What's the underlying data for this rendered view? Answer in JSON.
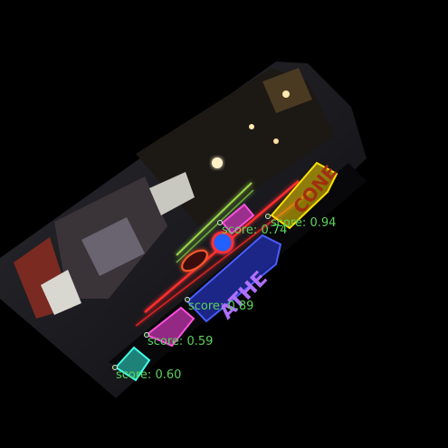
{
  "scene": {
    "description_key": "night-street-neon-signs-rotated",
    "background_color": "#000000",
    "accent_colors": {
      "neon_red": "#ff2d2d",
      "neon_green": "#9bd54a",
      "detection_yellow": "#f0d000",
      "detection_magenta": "#e03cc8",
      "detection_blue": "#2a3bd8",
      "detection_cyan": "#2fd3c2",
      "label_green": "#5ad35a"
    }
  },
  "detections": [
    {
      "id": "det-1",
      "score_text": "score: 0.94",
      "color": "#f0d000"
    },
    {
      "id": "det-2",
      "score_text": "score: 0.74",
      "color": "#e03cc8"
    },
    {
      "id": "det-3",
      "score_text": "score: 0.89",
      "color": "#2a3bd8"
    },
    {
      "id": "det-4",
      "score_text": "score: 0.59",
      "color": "#e03cc8"
    },
    {
      "id": "det-5",
      "score_text": "score: 0.60",
      "color": "#2fd3c2"
    }
  ]
}
